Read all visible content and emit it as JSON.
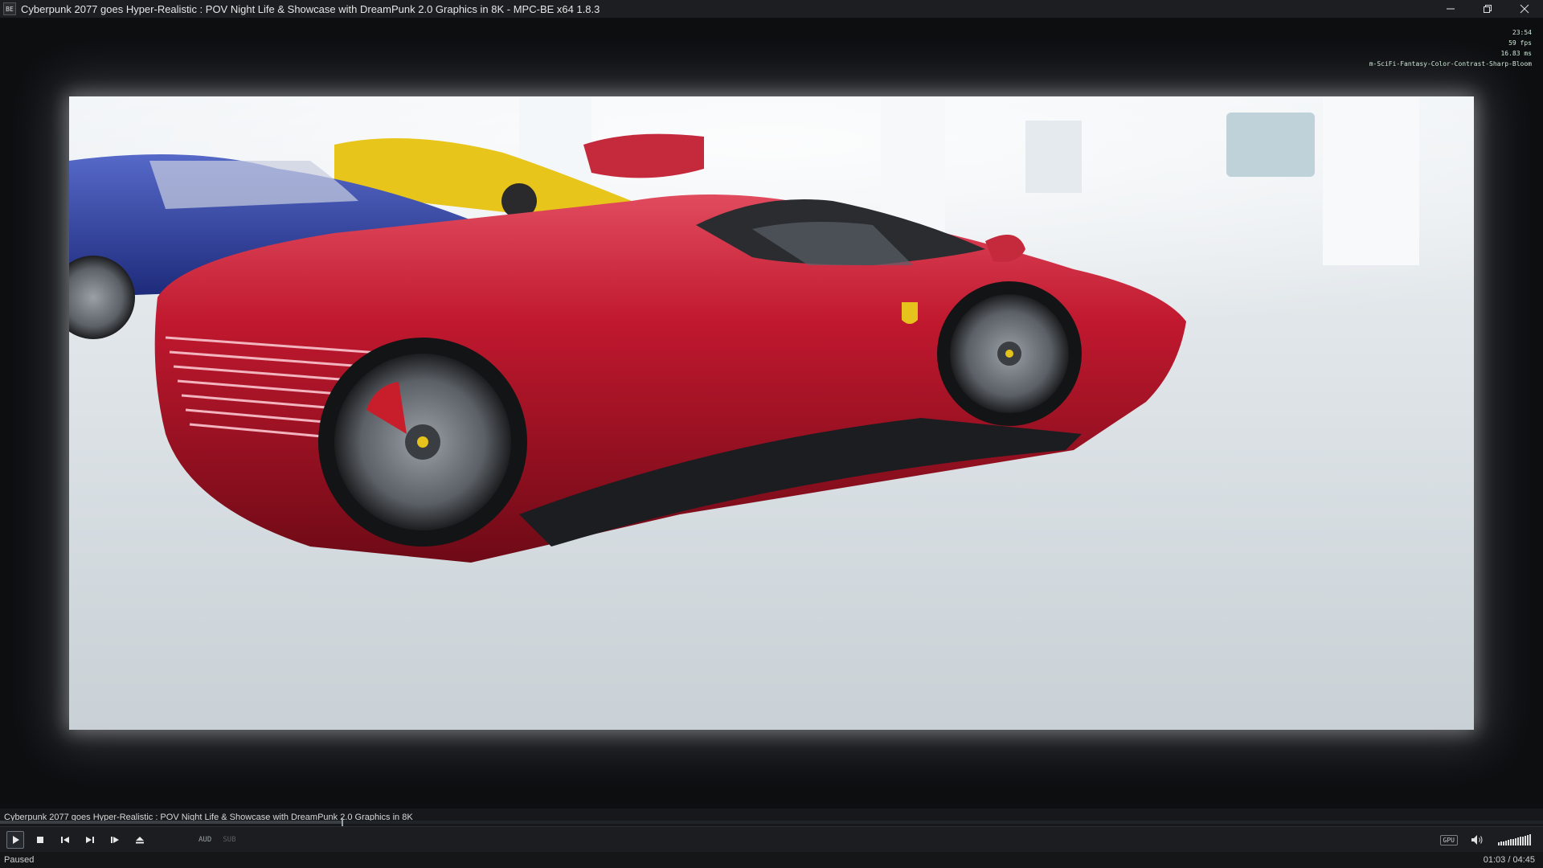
{
  "window": {
    "title": "Cyberpunk 2077 goes Hyper-Realistic : POV Night Life & Showcase with DreamPunk 2.0 Graphics in 8K - MPC-BE x64 1.8.3",
    "app_icon_text": "BE",
    "minimize_icon": "minimize-icon",
    "restore_icon": "restore-icon",
    "close_icon": "close-icon"
  },
  "osd": {
    "time": "23:54",
    "fps": "59 fps",
    "frame_time": "16.83 ms",
    "shader": "m-SciFi-Fantasy-Color-Contrast-Sharp-Bloom"
  },
  "info_line": {
    "text": "Cyberpunk 2077 goes Hyper-Realistic : POV Night Life & Showcase with DreamPunk 2.0 Graphics in 8K"
  },
  "seek": {
    "progress": 0.2218
  },
  "controls": {
    "buttons": [
      "play-icon",
      "stop-icon",
      "skip-back-icon",
      "skip-forward-icon",
      "frame-step-icon",
      "eject-icon"
    ],
    "audio_label": "AUD",
    "subtitle_label": "SUB",
    "gpu_label": "GPU",
    "volume_icon": "speaker-icon",
    "volume_level": 1.0
  },
  "status": {
    "state": "Paused",
    "time": "01:03 / 04:45"
  },
  "colors": {
    "car_red": "#b01426",
    "car_blue": "#2a3c9c",
    "car_yellow": "#e8c51a",
    "background": "#0d0e10"
  }
}
